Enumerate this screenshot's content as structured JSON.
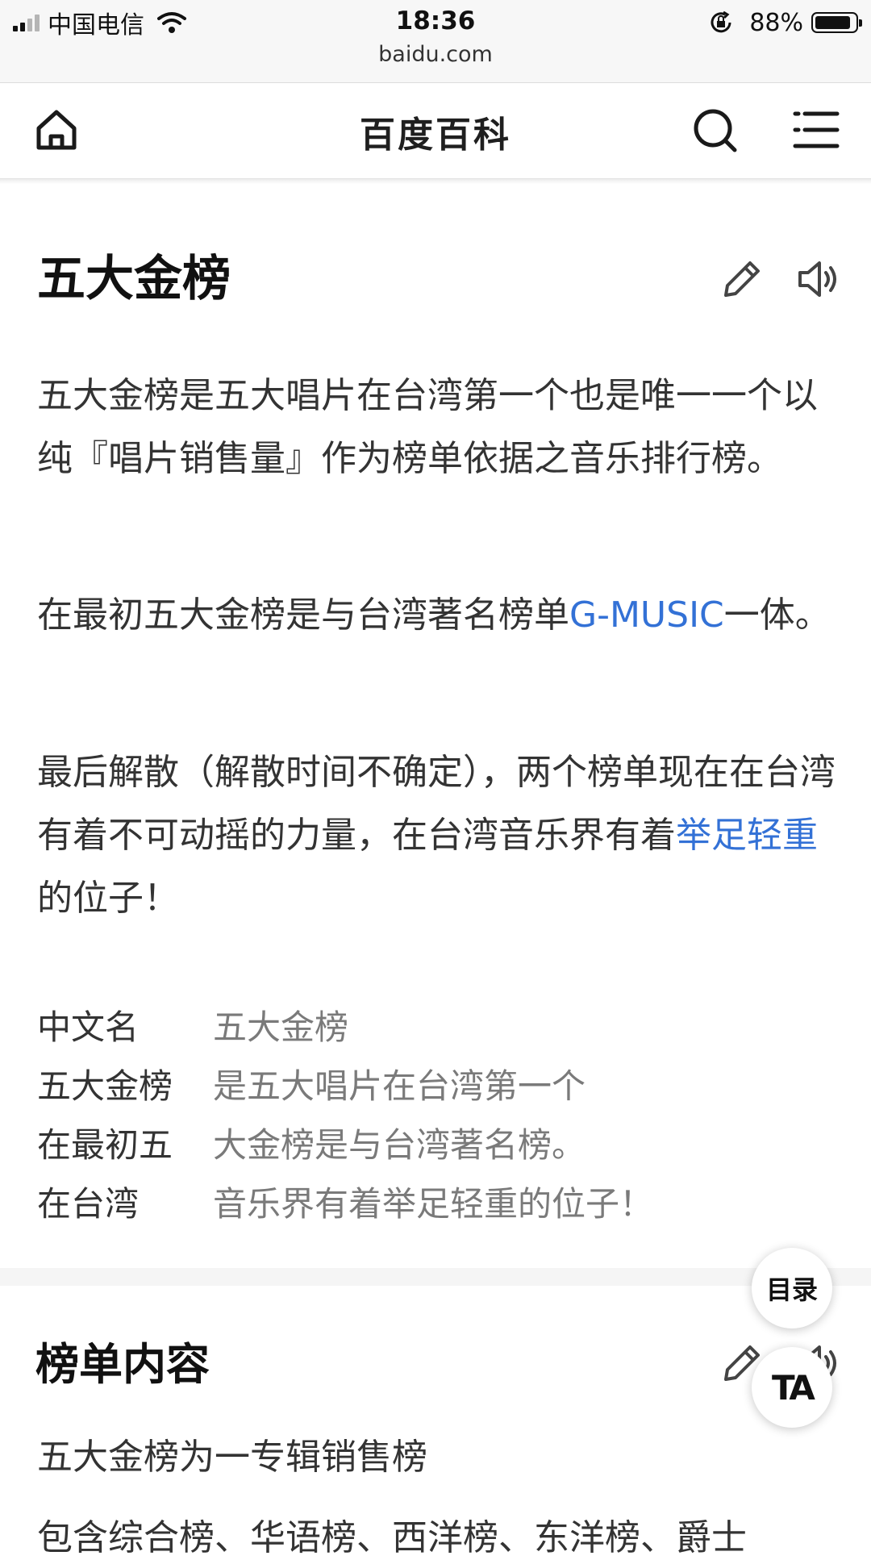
{
  "status_bar": {
    "carrier": "中国电信",
    "time": "18:36",
    "battery": "88%",
    "battery_level": 0.88,
    "url": "baidu.com"
  },
  "nav": {
    "title": "百度百科",
    "icons": [
      "home-icon",
      "search-icon",
      "menu-icon"
    ]
  },
  "article": {
    "title": "五大金榜",
    "paragraph1": "五大金榜是五大唱片在台湾第一个也是唯一一个以纯『唱片销售量』作为榜单依据之音乐排行榜。",
    "paragraph2": {
      "before": "在最初五大金榜是与台湾著名榜单",
      "link": "G-MUSIC",
      "after": "一体。"
    },
    "paragraph3": {
      "before": "最后解散（解散时间不确定），两个榜单现在在台湾有着不可动摇的力量，在台湾音乐界有着",
      "link": "举足轻重",
      "after": "的位子！"
    },
    "info_box": [
      {
        "label": "中文名",
        "value": "五大金榜"
      },
      {
        "label": "五大金榜",
        "value": "是五大唱片在台湾第一个"
      },
      {
        "label": "在最初五",
        "value": "大金榜是与台湾著名榜。"
      },
      {
        "label": "在台湾",
        "value": "音乐界有着举足轻重的位子！"
      }
    ]
  },
  "section2": {
    "title": "榜单内容",
    "line1": "五大金榜为一专辑销售榜",
    "line2": "包含综合榜、华语榜、西洋榜、东洋榜、爵士"
  },
  "floating": {
    "toc_label": "目录",
    "font_label": "TA"
  },
  "colors": {
    "link": "#3371d6",
    "text": "#333333",
    "muted": "#7a7a7a"
  }
}
